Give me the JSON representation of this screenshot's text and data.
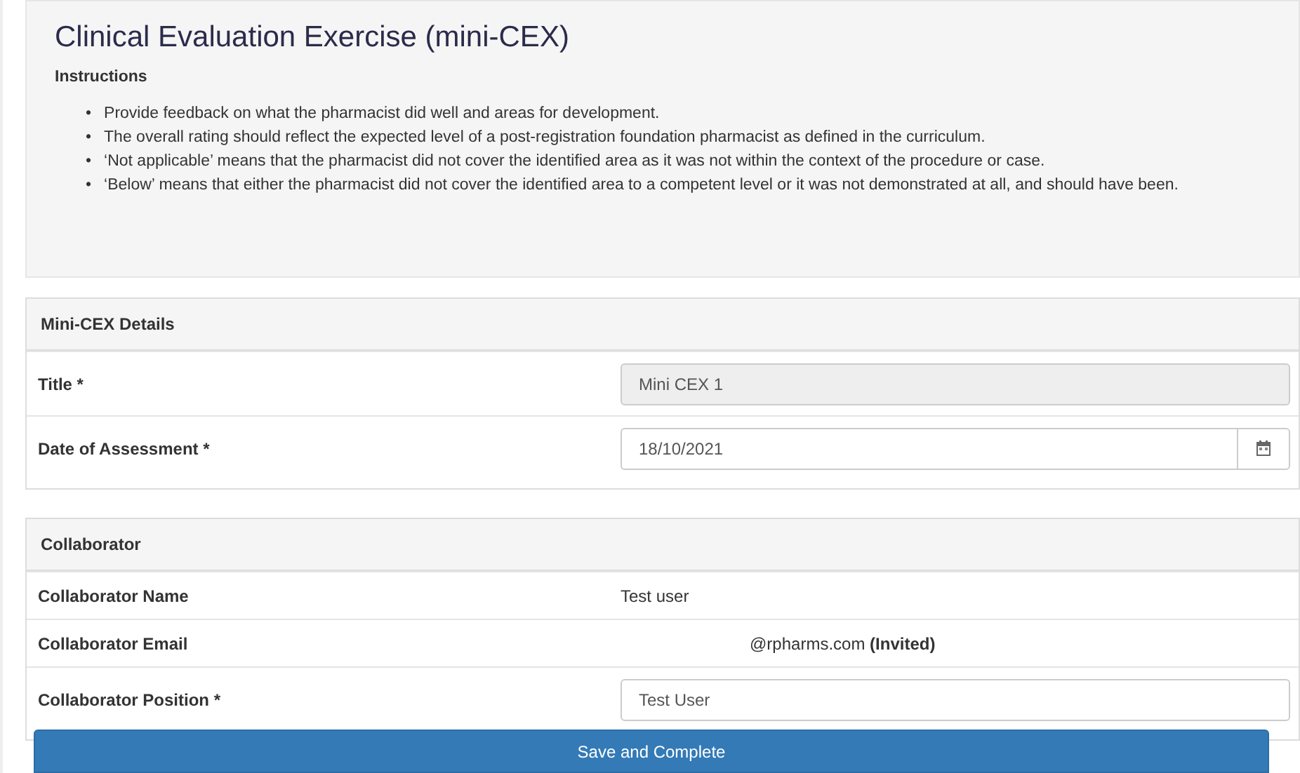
{
  "header": {
    "title": "Clinical Evaluation Exercise (mini-CEX)",
    "instructions_heading": "Instructions",
    "instructions": [
      {
        "marker": "•",
        "text": "Provide feedback on what the pharmacist did well and areas for development."
      },
      {
        "marker": "•",
        "text": "The overall rating should reflect the expected level of a post-registration foundation pharmacist as defined in the curriculum."
      },
      {
        "marker": "•",
        "text": "‘Not applicable’ means that the pharmacist did not cover the identified area as it was not within the context of the procedure or case."
      },
      {
        "marker": "•",
        "text": "‘Below’ means that either the pharmacist did not cover the identified area to a competent level or it was not demonstrated at all, and should have been."
      }
    ]
  },
  "sections": [
    {
      "heading": "Mini-CEX Details",
      "rows": [
        {
          "kind": "input",
          "label": "Title *",
          "value": "Mini CEX 1",
          "disabled": true
        },
        {
          "kind": "date",
          "label": "Date of Assessment *",
          "value": "18/10/2021",
          "disabled": false
        }
      ]
    },
    {
      "heading": "Collaborator",
      "rows": [
        {
          "kind": "text",
          "label": "Collaborator Name",
          "value": "Test user"
        },
        {
          "kind": "email",
          "label": "Collaborator Email",
          "value": "@rpharms.com **(Invited)**"
        },
        {
          "kind": "input",
          "label": "Collaborator Position *",
          "value": "Test User",
          "disabled": false
        }
      ]
    }
  ],
  "save_button": "Save and Complete"
}
